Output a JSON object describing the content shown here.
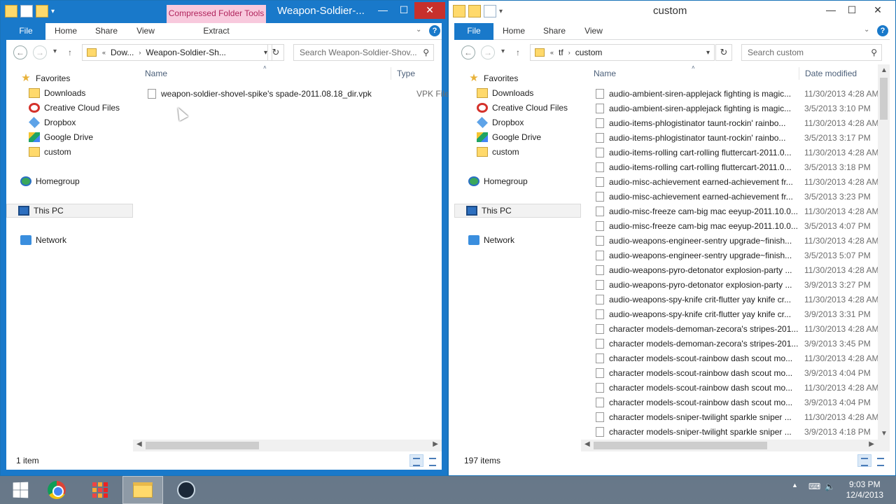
{
  "left_window": {
    "title": "Weapon-Soldier-...",
    "context_tab": "Compressed Folder Tools",
    "ribbon_tabs": [
      "File",
      "Home",
      "Share",
      "View",
      "Extract"
    ],
    "address": {
      "prefix": "«",
      "segments": [
        "Dow...",
        "Weapon-Soldier-Sh..."
      ]
    },
    "search_placeholder": "Search Weapon-Soldier-Shov...",
    "columns": {
      "name": "Name",
      "type": "Type"
    },
    "files": [
      {
        "name": "weapon-soldier-shovel-spike's spade-2011.08.18_dir.vpk",
        "type": "VPK File"
      }
    ],
    "status": "1 item"
  },
  "right_window": {
    "title": "custom",
    "ribbon_tabs": [
      "File",
      "Home",
      "Share",
      "View"
    ],
    "address": {
      "prefix": "«",
      "segments": [
        "tf",
        "custom"
      ]
    },
    "search_placeholder": "Search custom",
    "columns": {
      "name": "Name",
      "date": "Date modified"
    },
    "files": [
      {
        "name": "audio-ambient-siren-applejack fighting is magic...",
        "date": "11/30/2013 4:28 AM"
      },
      {
        "name": "audio-ambient-siren-applejack fighting is magic...",
        "date": "3/5/2013 3:10 PM"
      },
      {
        "name": "audio-items-phlogistinator taunt-rockin' rainbo...",
        "date": "11/30/2013 4:28 AM"
      },
      {
        "name": "audio-items-phlogistinator taunt-rockin' rainbo...",
        "date": "3/5/2013 3:17 PM"
      },
      {
        "name": "audio-items-rolling cart-rolling fluttercart-2011.0...",
        "date": "11/30/2013 4:28 AM"
      },
      {
        "name": "audio-items-rolling cart-rolling fluttercart-2011.0...",
        "date": "3/5/2013 3:18 PM"
      },
      {
        "name": "audio-misc-achievement earned-achievement fr...",
        "date": "11/30/2013 4:28 AM"
      },
      {
        "name": "audio-misc-achievement earned-achievement fr...",
        "date": "3/5/2013 3:23 PM"
      },
      {
        "name": "audio-misc-freeze cam-big mac eeyup-2011.10.0...",
        "date": "11/30/2013 4:28 AM"
      },
      {
        "name": "audio-misc-freeze cam-big mac eeyup-2011.10.0...",
        "date": "3/5/2013 4:07 PM"
      },
      {
        "name": "audio-weapons-engineer-sentry upgrade~finish...",
        "date": "11/30/2013 4:28 AM"
      },
      {
        "name": "audio-weapons-engineer-sentry upgrade~finish...",
        "date": "3/5/2013 5:07 PM"
      },
      {
        "name": "audio-weapons-pyro-detonator explosion-party ...",
        "date": "11/30/2013 4:28 AM"
      },
      {
        "name": "audio-weapons-pyro-detonator explosion-party ...",
        "date": "3/9/2013 3:27 PM"
      },
      {
        "name": "audio-weapons-spy-knife crit-flutter yay knife cr...",
        "date": "11/30/2013 4:28 AM"
      },
      {
        "name": "audio-weapons-spy-knife crit-flutter yay knife cr...",
        "date": "3/9/2013 3:31 PM"
      },
      {
        "name": "character models-demoman-zecora's stripes-201...",
        "date": "11/30/2013 4:28 AM"
      },
      {
        "name": "character models-demoman-zecora's stripes-201...",
        "date": "3/9/2013 3:45 PM"
      },
      {
        "name": "character models-scout-rainbow dash scout mo...",
        "date": "11/30/2013 4:28 AM"
      },
      {
        "name": "character models-scout-rainbow dash scout mo...",
        "date": "3/9/2013 4:04 PM"
      },
      {
        "name": "character models-scout-rainbow dash scout mo...",
        "date": "11/30/2013 4:28 AM"
      },
      {
        "name": "character models-scout-rainbow dash scout mo...",
        "date": "3/9/2013 4:04 PM"
      },
      {
        "name": "character models-sniper-twilight sparkle sniper ...",
        "date": "11/30/2013 4:28 AM"
      },
      {
        "name": "character models-sniper-twilight sparkle sniper ...",
        "date": "3/9/2013 4:18 PM"
      }
    ],
    "status": "197 items"
  },
  "nav_pane": {
    "favorites": "Favorites",
    "items": [
      "Downloads",
      "Creative Cloud Files",
      "Dropbox",
      "Google Drive",
      "custom"
    ],
    "homegroup": "Homegroup",
    "this_pc": "This PC",
    "network": "Network"
  },
  "icons": {
    "back": "←",
    "forward": "→",
    "up": "↑",
    "refresh": "↻",
    "search": "⚲",
    "dropdown": "▾",
    "chevron": "›",
    "minimize": "—",
    "maximize": "☐",
    "close": "✕",
    "help": "?",
    "ribbon_collapse": "⌄",
    "sort": "˄",
    "scroll_left": "◀",
    "scroll_right": "▶",
    "scroll_up": "▲",
    "scroll_down": "▼",
    "tray_up": "▲",
    "tray_network": "⌨",
    "tray_volume": "🔈"
  },
  "taskbar": {
    "time": "9:03 PM",
    "date": "12/4/2013"
  },
  "colors": {
    "frame": "#1979ca",
    "close": "#c7302c",
    "context_tab": "#f8c9dd"
  }
}
